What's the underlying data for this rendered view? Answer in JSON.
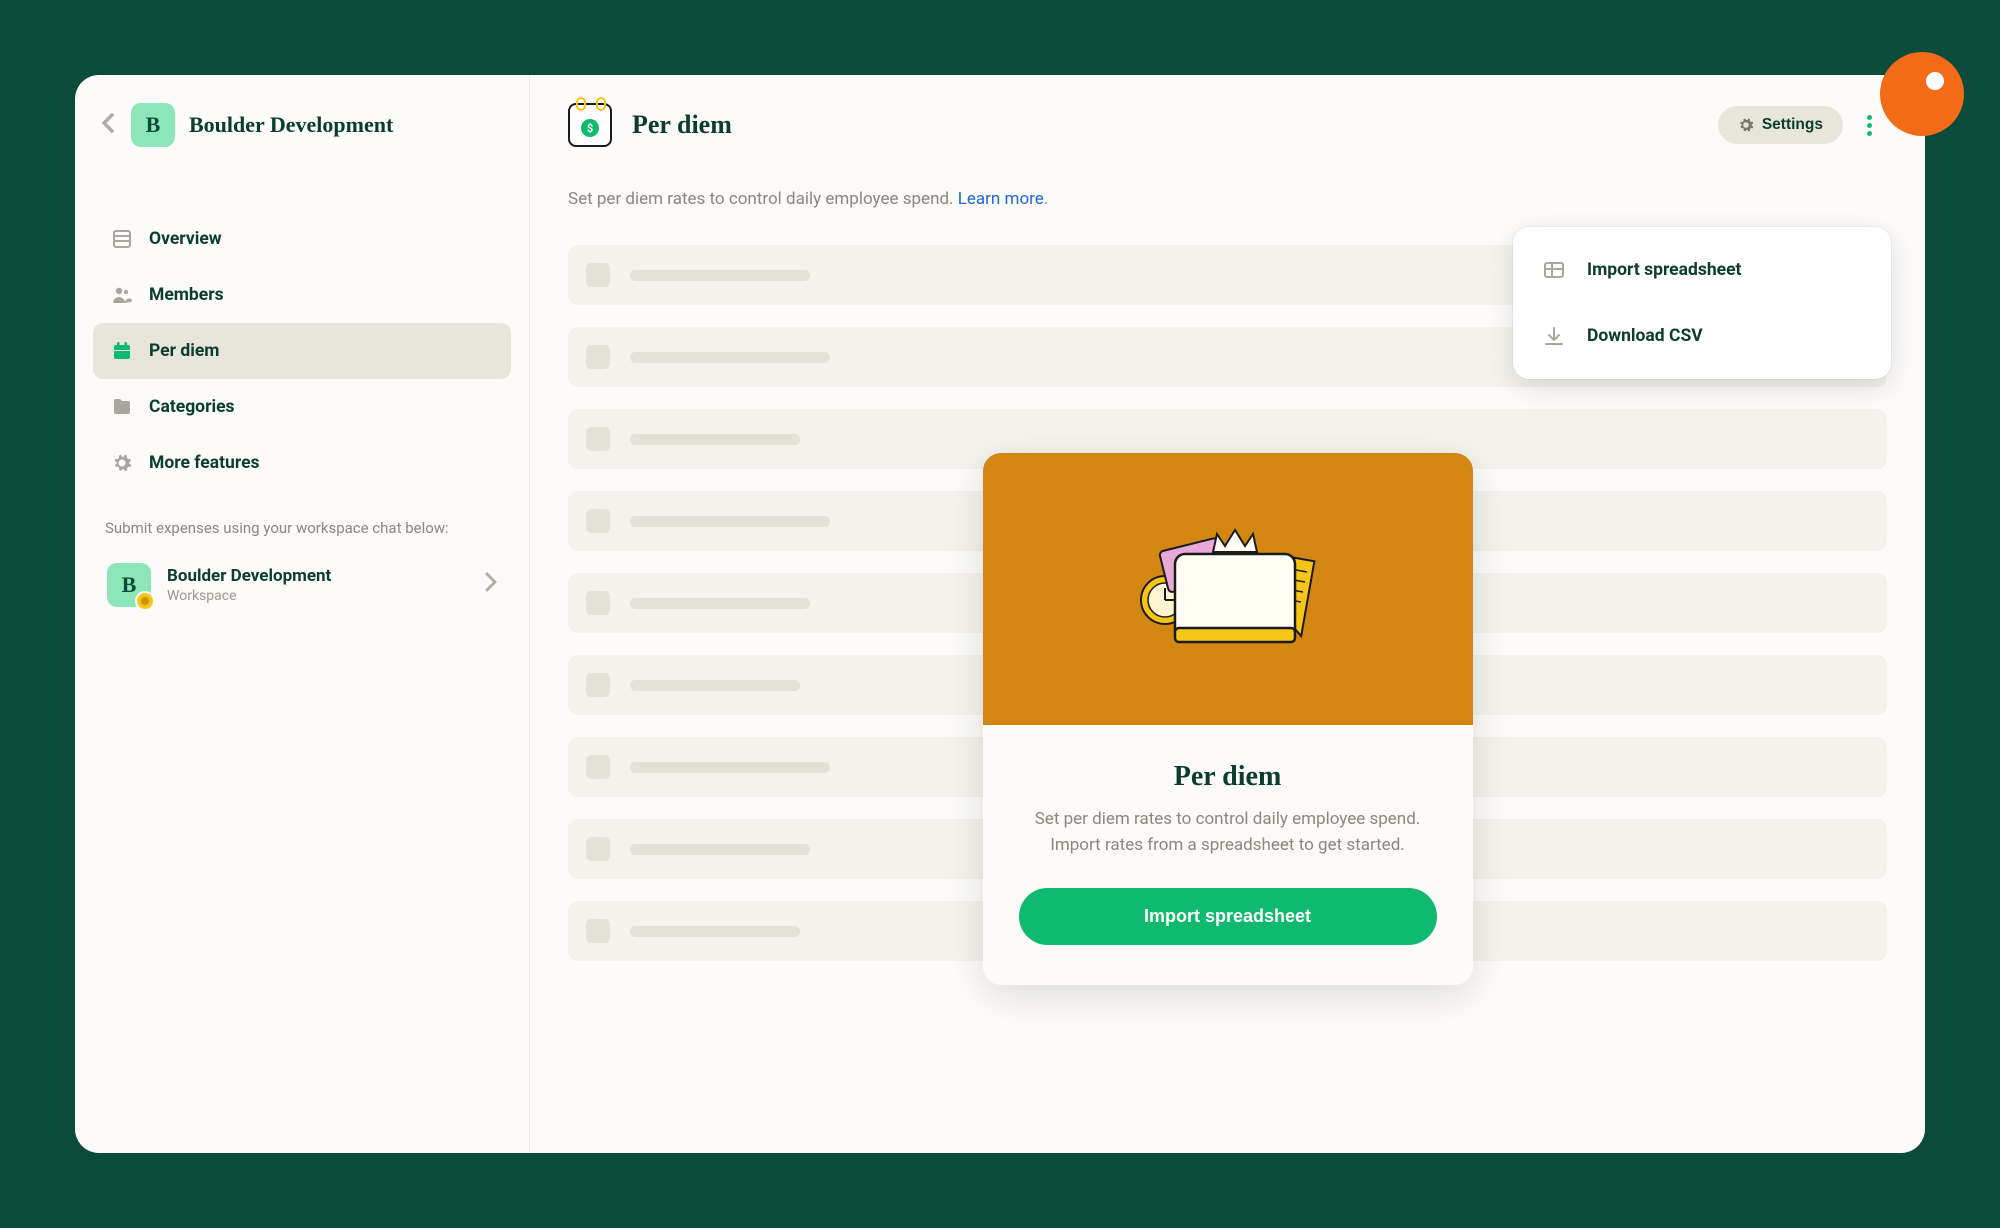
{
  "workspace": {
    "name": "Boulder Development",
    "initial": "B"
  },
  "sidebar": {
    "items": [
      {
        "label": "Overview"
      },
      {
        "label": "Members"
      },
      {
        "label": "Per diem"
      },
      {
        "label": "Categories"
      },
      {
        "label": "More features"
      }
    ],
    "hint": "Submit expenses using your workspace chat below:",
    "chat": {
      "name": "Boulder Development",
      "subtitle": "Workspace",
      "initial": "B"
    }
  },
  "main": {
    "title": "Per diem",
    "icon_dollar": "$",
    "subtitle_text": "Set per diem rates to control daily employee spend.",
    "learn_more": "Learn more",
    "settings_label": "Settings"
  },
  "dropdown": {
    "import": "Import spreadsheet",
    "download": "Download CSV"
  },
  "modal": {
    "title": "Per diem",
    "description": "Set per diem rates to control daily employee spend. Import rates from a spreadsheet to get started.",
    "cta": "Import spreadsheet"
  }
}
